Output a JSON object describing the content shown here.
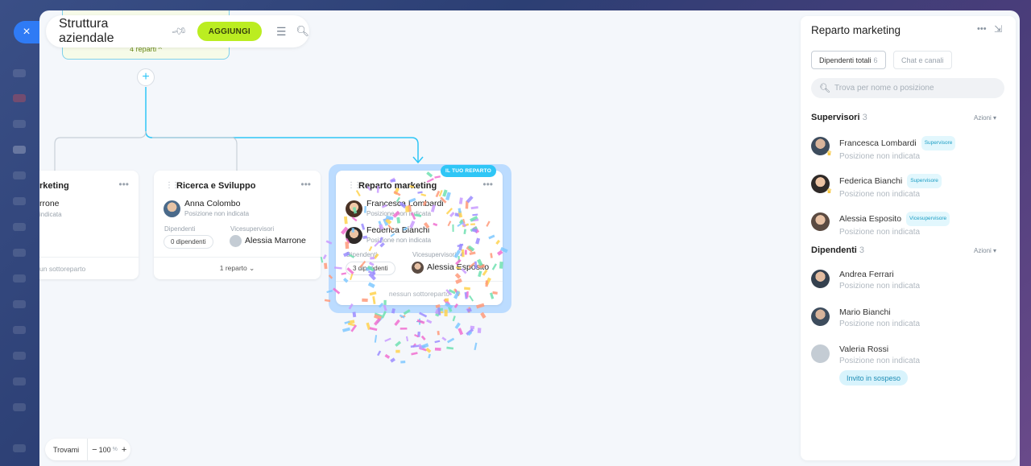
{
  "close_label": "×",
  "header": {
    "title": "Struttura aziendale",
    "add_label": "AGGIUNGI"
  },
  "icons": {
    "pin": "pin-icon",
    "menu": "hamburger-menu-icon",
    "search": "search-icon"
  },
  "top_card": {
    "subtitle": "4 reparti ^"
  },
  "cards": {
    "marketing_partial": {
      "title": "rketing",
      "person_name": "rrone",
      "person_pos": "indicata",
      "footer": "un sottoreparto"
    },
    "ricerca": {
      "title": "Ricerca e Sviluppo",
      "head_name": "Anna Colombo",
      "head_pos": "Posizione non indicata",
      "employees_label": "Dipendenti",
      "employees_count": "0 dipendenti",
      "deputy_label": "Vicesupervisori",
      "deputy_name": "Alessia Marrone",
      "footer": "1 reparto ⌄"
    },
    "reparto": {
      "badge": "IL TUO REPARTO",
      "title": "Reparto marketing",
      "head1_name": "Francesca Lombardi",
      "head1_pos": "Posizione non indicata",
      "head2_name": "Federica Bianchi",
      "head2_pos": "Posizione non indicata",
      "employees_label": "Dipendenti",
      "employees_count": "3 dipendenti",
      "deputy_label": "Vicesupervisori",
      "deputy_name": "Alessia Esposito",
      "footer": "nessun sottoreparto"
    }
  },
  "zoom": {
    "find_label": "Trovami",
    "minus": "−",
    "value": "100",
    "unit": "%",
    "plus": "+"
  },
  "right_panel": {
    "title": "Reparto marketing",
    "tabs": [
      {
        "label": "Dipendenti totali",
        "count": "6"
      },
      {
        "label": "Chat e canali"
      }
    ],
    "search_placeholder": "Trova per nome o posizione",
    "supervisors": {
      "label": "Supervisori",
      "count": "3",
      "action": "Azioni ▾",
      "people": [
        {
          "name": "Francesca Lombardi",
          "role": "Supervisore",
          "pos": "Posizione non indicata"
        },
        {
          "name": "Federica Bianchi",
          "role": "Supervisore",
          "pos": "Posizione non indicata"
        },
        {
          "name": "Alessia Esposito",
          "role": "Vicesupervisore",
          "pos": "Posizione non indicata"
        }
      ]
    },
    "employees": {
      "label": "Dipendenti",
      "count": "3",
      "action": "Azioni ▾",
      "people": [
        {
          "name": "Andrea Ferrari",
          "pos": "Posizione non indicata"
        },
        {
          "name": "Mario Bianchi",
          "pos": "Posizione non indicata"
        },
        {
          "name": "Valeria Rossi",
          "pos": "Posizione non indicata"
        }
      ],
      "invite_label": "Invito in sospeso"
    }
  },
  "colors": {
    "accent_blue": "#2fc6f6",
    "add_green": "#bbed21",
    "close_blue": "#2f7bf5"
  }
}
